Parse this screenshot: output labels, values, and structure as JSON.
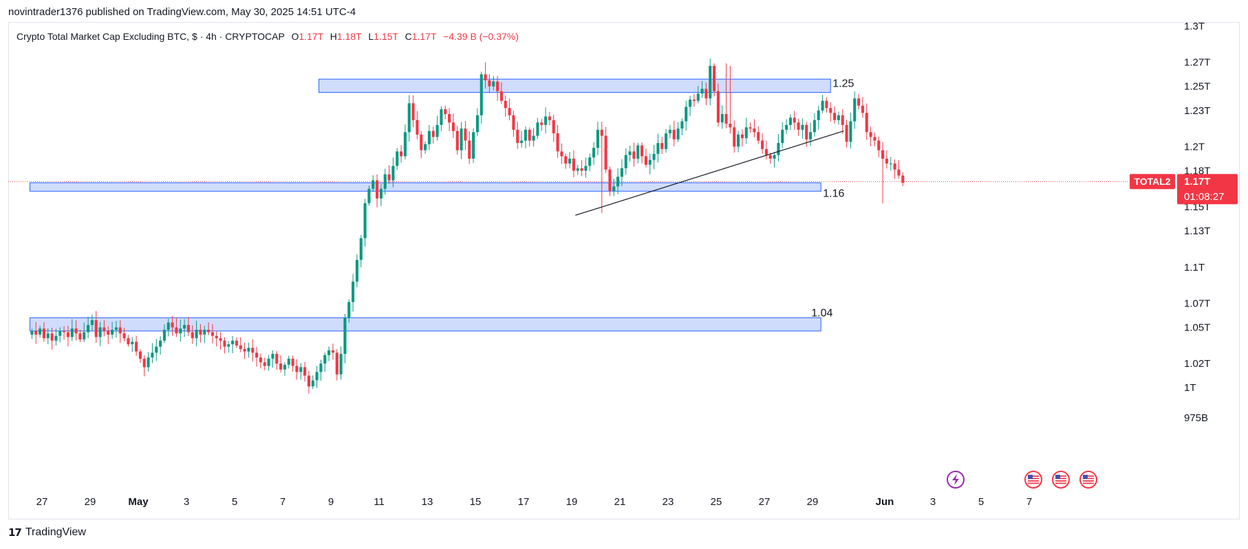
{
  "header": {
    "publisher_line": "novintrader1376 published on TradingView.com, May 30, 2025 14:51 UTC-4"
  },
  "legend": {
    "symbol_desc": "Crypto Total Market Cap Excluding BTC, $ · 4h · CRYPTOCAP",
    "o_label": "O",
    "o_value": "1.17T",
    "h_label": "H",
    "h_value": "1.18T",
    "l_label": "L",
    "l_value": "1.15T",
    "c_label": "C",
    "c_value": "1.17T",
    "change": "−4.39 B (−0.37%)"
  },
  "footer": {
    "brand_logo_text": "17",
    "brand_name": "TradingView"
  },
  "colors": {
    "up": "#089981",
    "down": "#f23645",
    "zone_fill": "#cfdcfb",
    "zone_border": "#2962ff",
    "last_price_bg": "#f23645",
    "purple_event": "#9c27b0"
  },
  "icons": {
    "event_icons": [
      "lightning-event-icon",
      "us-flag-event-icon",
      "us-flag-event-icon",
      "us-flag-event-icon"
    ]
  },
  "chart_data": {
    "type": "candlestick",
    "symbol": "TOTAL2",
    "interval": "4h",
    "y_unit": "T",
    "ylim": [
      0.965,
      1.305
    ],
    "y_ticks": [
      {
        "value": 1.3,
        "label": "1.3T"
      },
      {
        "value": 1.27,
        "label": "1.27T"
      },
      {
        "value": 1.25,
        "label": "1.25T"
      },
      {
        "value": 1.23,
        "label": "1.23T"
      },
      {
        "value": 1.2,
        "label": "1.2T"
      },
      {
        "value": 1.18,
        "label": "1.18T"
      },
      {
        "value": 1.15,
        "label": "1.15T"
      },
      {
        "value": 1.13,
        "label": "1.13T"
      },
      {
        "value": 1.1,
        "label": "1.1T"
      },
      {
        "value": 1.07,
        "label": "1.07T"
      },
      {
        "value": 1.05,
        "label": "1.05T"
      },
      {
        "value": 1.02,
        "label": "1.02T"
      },
      {
        "value": 1.0,
        "label": "1T"
      },
      {
        "value": 0.975,
        "label": "975B"
      }
    ],
    "x_ticks": [
      {
        "day": -3,
        "label": "27"
      },
      {
        "day": -1,
        "label": "29"
      },
      {
        "day": 1,
        "label": "May"
      },
      {
        "day": 3,
        "label": "3"
      },
      {
        "day": 5,
        "label": "5"
      },
      {
        "day": 7,
        "label": "7"
      },
      {
        "day": 9,
        "label": "9"
      },
      {
        "day": 11,
        "label": "11"
      },
      {
        "day": 13,
        "label": "13"
      },
      {
        "day": 15,
        "label": "15"
      },
      {
        "day": 17,
        "label": "17"
      },
      {
        "day": 19,
        "label": "19"
      },
      {
        "day": 21,
        "label": "21"
      },
      {
        "day": 23,
        "label": "23"
      },
      {
        "day": 25,
        "label": "25"
      },
      {
        "day": 27,
        "label": "27"
      },
      {
        "day": 29,
        "label": "29"
      },
      {
        "day": 32,
        "label": "Jun"
      },
      {
        "day": 34,
        "label": "3"
      },
      {
        "day": 36,
        "label": "5"
      },
      {
        "day": 38,
        "label": "7"
      }
    ],
    "closes": [
      1.047,
      1.044,
      1.049,
      1.041,
      1.045,
      1.039,
      1.043,
      1.047,
      1.046,
      1.042,
      1.049,
      1.045,
      1.04,
      1.046,
      1.052,
      1.056,
      1.042,
      1.05,
      1.047,
      1.044,
      1.048,
      1.05,
      1.045,
      1.041,
      1.036,
      1.038,
      1.03,
      1.024,
      1.017,
      1.025,
      1.029,
      1.034,
      1.039,
      1.048,
      1.054,
      1.05,
      1.045,
      1.049,
      1.052,
      1.046,
      1.041,
      1.048,
      1.044,
      1.048,
      1.046,
      1.043,
      1.041,
      1.039,
      1.034,
      1.036,
      1.039,
      1.035,
      1.032,
      1.03,
      1.033,
      1.029,
      1.025,
      1.021,
      1.018,
      1.024,
      1.028,
      1.02,
      1.015,
      1.019,
      1.024,
      1.018,
      1.013,
      1.017,
      1.01,
      1.001,
      1.006,
      1.013,
      1.02,
      1.027,
      1.031,
      1.029,
      1.011,
      1.028,
      1.058,
      1.071,
      1.088,
      1.106,
      1.124,
      1.153,
      1.165,
      1.172,
      1.157,
      1.165,
      1.177,
      1.172,
      1.184,
      1.196,
      1.192,
      1.212,
      1.236,
      1.222,
      1.21,
      1.197,
      1.202,
      1.213,
      1.208,
      1.218,
      1.231,
      1.227,
      1.22,
      1.213,
      1.197,
      1.215,
      1.205,
      1.19,
      1.212,
      1.226,
      1.26,
      1.255,
      1.25,
      1.254,
      1.246,
      1.238,
      1.232,
      1.226,
      1.214,
      1.203,
      1.205,
      1.214,
      1.205,
      1.209,
      1.22,
      1.218,
      1.225,
      1.222,
      1.211,
      1.196,
      1.192,
      1.186,
      1.19,
      1.18,
      1.182,
      1.18,
      1.184,
      1.191,
      1.199,
      1.214,
      1.209,
      1.181,
      1.163,
      1.167,
      1.175,
      1.182,
      1.193,
      1.196,
      1.19,
      1.201,
      1.192,
      1.185,
      1.189,
      1.194,
      1.203,
      1.198,
      1.211,
      1.214,
      1.206,
      1.215,
      1.221,
      1.233,
      1.239,
      1.238,
      1.244,
      1.248,
      1.24,
      1.267,
      1.246,
      1.22,
      1.227,
      1.219,
      1.216,
      1.2,
      1.21,
      1.207,
      1.216,
      1.215,
      1.212,
      1.205,
      1.198,
      1.193,
      1.19,
      1.193,
      1.203,
      1.214,
      1.218,
      1.224,
      1.22,
      1.214,
      1.218,
      1.206,
      1.212,
      1.222,
      1.23,
      1.238,
      1.232,
      1.228,
      1.222,
      1.226,
      1.218,
      1.204,
      1.221,
      1.24,
      1.234,
      1.228,
      1.212,
      1.208,
      1.205,
      1.197,
      1.19,
      1.186,
      1.186,
      1.181,
      1.176,
      1.17
    ],
    "first_open": 1.044,
    "first_day": -3.5,
    "bars_per_day": 6,
    "overrides": [
      {
        "i": 113,
        "high": 1.27
      },
      {
        "i": 173,
        "high": 1.269
      },
      {
        "i": 174,
        "high": 1.267
      },
      {
        "i": 76,
        "low": 1.006
      },
      {
        "i": 142,
        "low": 1.145
      },
      {
        "i": 197,
        "high": 1.243
      },
      {
        "i": 212,
        "low": 1.153
      }
    ],
    "zones": [
      {
        "name": "resistance-zone",
        "y_top": 1.256,
        "y_bottom": 1.245,
        "day_start": 8.5,
        "day_end": 29.75,
        "label": "1.25"
      },
      {
        "name": "support-zone",
        "y_top": 1.17,
        "y_bottom": 1.163,
        "day_start": -3.5,
        "day_end": 29.35,
        "label": "1.16"
      },
      {
        "name": "demand-zone",
        "y_top": 1.058,
        "y_bottom": 1.047,
        "day_start": -3.5,
        "day_end": 29.35,
        "label": "1.04"
      }
    ],
    "trendline": {
      "day_start": 19.15,
      "y_start": 1.143,
      "day_end": 30.3,
      "y_end": 1.213
    },
    "last_price": {
      "symbol": "TOTAL2",
      "value": 1.171,
      "price_label": "1.17T",
      "countdown": "01:08:27"
    }
  }
}
